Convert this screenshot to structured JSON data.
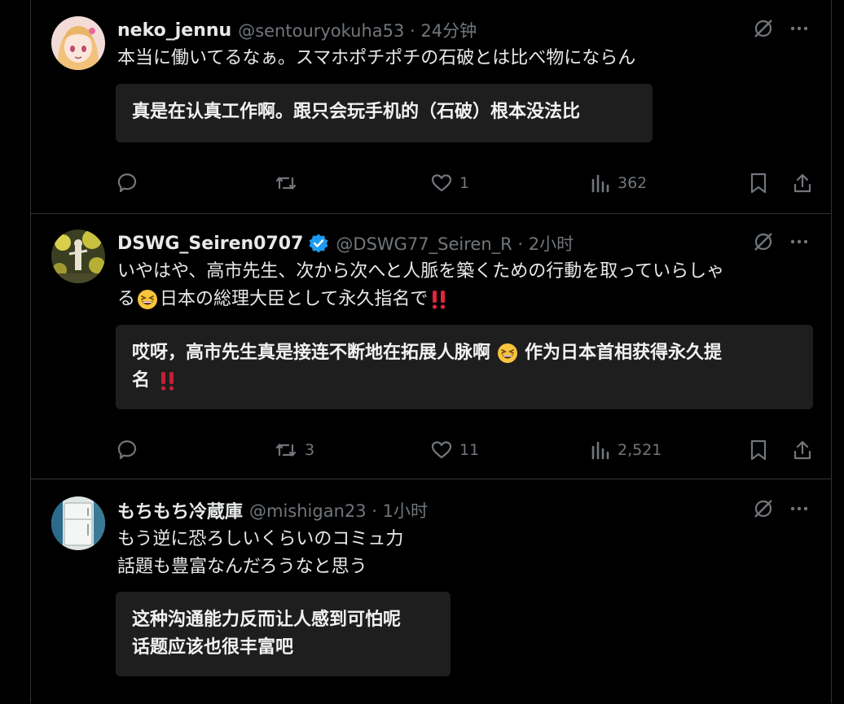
{
  "colors": {
    "background": "#000000",
    "text": "#e7e9ea",
    "muted": "#71767b",
    "translation_bg": "#1e1e1e",
    "verified": "#1d9bf0",
    "separator": "#2f3336"
  },
  "tweets": [
    {
      "name": "neko_jennu",
      "meta": "@sentouryokuha53 · 24分钟",
      "verified": false,
      "body_lines": [
        "本当に働いてるなぁ。スマホポチポチの石破とは比べ物にならん"
      ],
      "translation_lines": [
        "真是在认真工作啊。跟只会玩手机的（石破）根本没法比"
      ],
      "actions": {
        "reply": "",
        "retweet": "",
        "like": "1",
        "views": "362"
      },
      "icons": [
        "grok-icon",
        "more-icon",
        "reply-icon",
        "retweet-icon",
        "like-icon",
        "views-icon",
        "bookmark-icon",
        "share-icon"
      ]
    },
    {
      "name": "DSWG_Seiren0707",
      "meta": "@DSWG77_Seiren_R · 2小时",
      "verified": true,
      "body_lines": [
        "いやはや、高市先生、次から次へと人脈を築くための行動を取っていらしゃ",
        "る",
        "日本の総理大臣として永久指名で"
      ],
      "translation_lines": [
        "哎呀，高市先生真是接连不断地在拓展人脉啊",
        "作为日本首相获得永久提",
        "名"
      ],
      "actions": {
        "reply": "",
        "retweet": "3",
        "like": "11",
        "views": "2,521"
      },
      "icons": [
        "grok-icon",
        "more-icon",
        "grin-emoji-icon",
        "double-exclamation-icon"
      ]
    },
    {
      "name": "もちもち冷蔵庫",
      "meta": "@mishigan23 · 1小时",
      "verified": false,
      "body_lines": [
        "もう逆に恐ろしいくらいのコミュ力",
        "話題も豊富なんだろうなと思う"
      ],
      "translation_lines": [
        "这种沟通能力反而让人感到可怕呢",
        "话题应该也很丰富吧"
      ],
      "icons": [
        "grok-icon",
        "more-icon"
      ]
    }
  ]
}
